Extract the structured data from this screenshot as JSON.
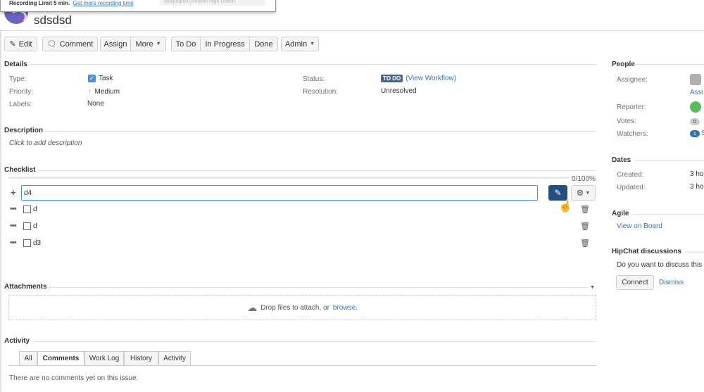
{
  "recording": {
    "text": "Recording Limit 5 min.",
    "link": "Get more recording time",
    "mic": "Микрофон (Realtek High Definit"
  },
  "issue": {
    "title": "sdsdsd"
  },
  "toolbar": {
    "edit": "Edit",
    "comment": "Comment",
    "assign": "Assign",
    "more": "More",
    "todo": "To Do",
    "inprogress": "In Progress",
    "done": "Done",
    "admin": "Admin"
  },
  "details": {
    "heading": "Details",
    "type_label": "Type:",
    "type_value": "Task",
    "priority_label": "Priority:",
    "priority_value": "Medium",
    "labels_label": "Labels:",
    "labels_value": "None",
    "status_label": "Status:",
    "status_value": "TO DO",
    "status_link": "(View Workflow)",
    "resolution_label": "Resolution:",
    "resolution_value": "Unresolved"
  },
  "description": {
    "heading": "Description",
    "placeholder": "Click to add description"
  },
  "checklist": {
    "heading": "Checklist",
    "progress_percent": 0,
    "progress_text": "0/100%",
    "input_value": "d4",
    "items": [
      {
        "text": "d",
        "checked": false
      },
      {
        "text": "d",
        "checked": false
      },
      {
        "text": "d3",
        "checked": false
      }
    ]
  },
  "attachments": {
    "heading": "Attachments",
    "drop_text": "Drop files to attach, or",
    "browse": "browse."
  },
  "activity": {
    "heading": "Activity",
    "tabs": [
      "All",
      "Comments",
      "Work Log",
      "History",
      "Activity"
    ],
    "active_tab": "Comments",
    "empty": "There are no comments yet on this issue."
  },
  "people": {
    "heading": "People",
    "assignee_label": "Assignee:",
    "assignee_link": "Assi",
    "reporter_label": "Reporter:",
    "votes_label": "Votes:",
    "votes_count": "0",
    "watchers_label": "Watchers:",
    "watchers_count": "1",
    "watchers_link": "S"
  },
  "dates": {
    "heading": "Dates",
    "created_label": "Created:",
    "created_value": "3 ho",
    "updated_label": "Updated:",
    "updated_value": "3 ho"
  },
  "agile": {
    "heading": "Agile",
    "view_board": "View on Board"
  },
  "hipchat": {
    "heading": "HipChat discussions",
    "question": "Do you want to discuss this",
    "connect": "Connect",
    "dismiss": "Dismiss"
  },
  "colors": {
    "link": "#3572b0",
    "primary_button": "#205081",
    "status_lozenge": "#4a6785",
    "priority": "#f0a000"
  }
}
